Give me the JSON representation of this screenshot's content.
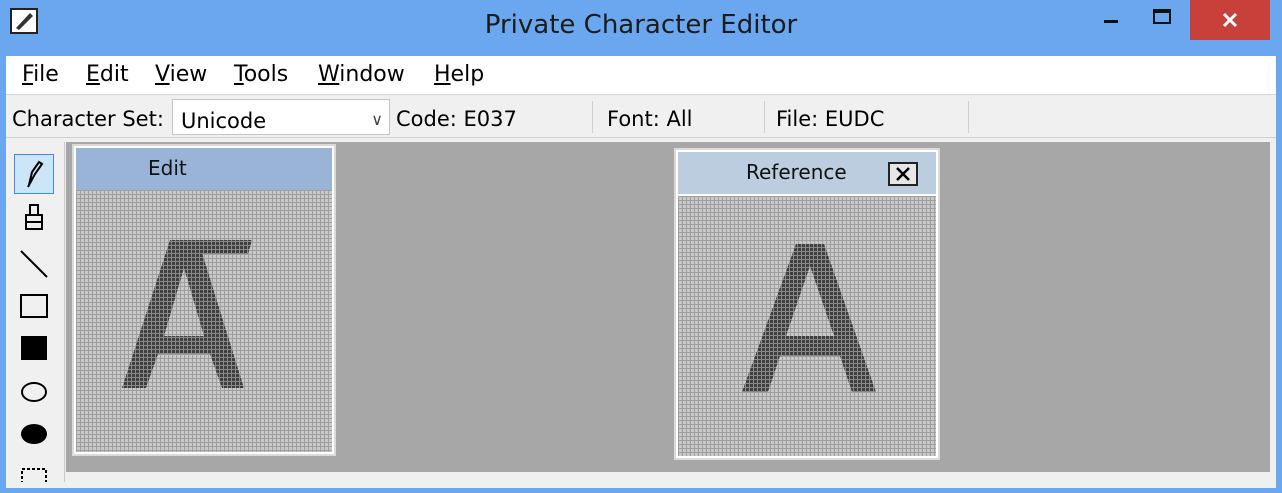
{
  "window": {
    "title": "Private Character Editor",
    "icons": {
      "app": "pencil-edit-icon",
      "minimize": "minimize-icon",
      "maximize": "maximize-icon",
      "close": "close-icon"
    }
  },
  "menu": [
    {
      "label": "File",
      "mnemonic": "F"
    },
    {
      "label": "Edit",
      "mnemonic": "E"
    },
    {
      "label": "View",
      "mnemonic": "V"
    },
    {
      "label": "Tools",
      "mnemonic": "T"
    },
    {
      "label": "Window",
      "mnemonic": "W"
    },
    {
      "label": "Help",
      "mnemonic": "H"
    }
  ],
  "status": {
    "charset_label": "Character Set:",
    "charset_value": "Unicode",
    "code": "Code: E037",
    "font": "Font: All",
    "file": "File: EUDC"
  },
  "tools": [
    {
      "name": "pencil-icon",
      "selected": true
    },
    {
      "name": "brush-icon",
      "selected": false
    },
    {
      "name": "line-icon",
      "selected": false
    },
    {
      "name": "hollow-rectangle-icon",
      "selected": false
    },
    {
      "name": "filled-rectangle-icon",
      "selected": false
    },
    {
      "name": "hollow-ellipse-icon",
      "selected": false
    },
    {
      "name": "filled-ellipse-icon",
      "selected": false
    },
    {
      "name": "rectangular-selection-icon",
      "selected": false
    }
  ],
  "edit_window": {
    "title": "Edit"
  },
  "reference_window": {
    "title": "Reference",
    "close_icon": "close-icon"
  },
  "colors": {
    "titlebar": "#6aa7ee",
    "close_button": "#c7403a",
    "workspace": "#a7a7a7",
    "edit_active_title": "#9ab4d8",
    "reference_title": "#bccde0",
    "glyph": "#4a4a4a"
  }
}
